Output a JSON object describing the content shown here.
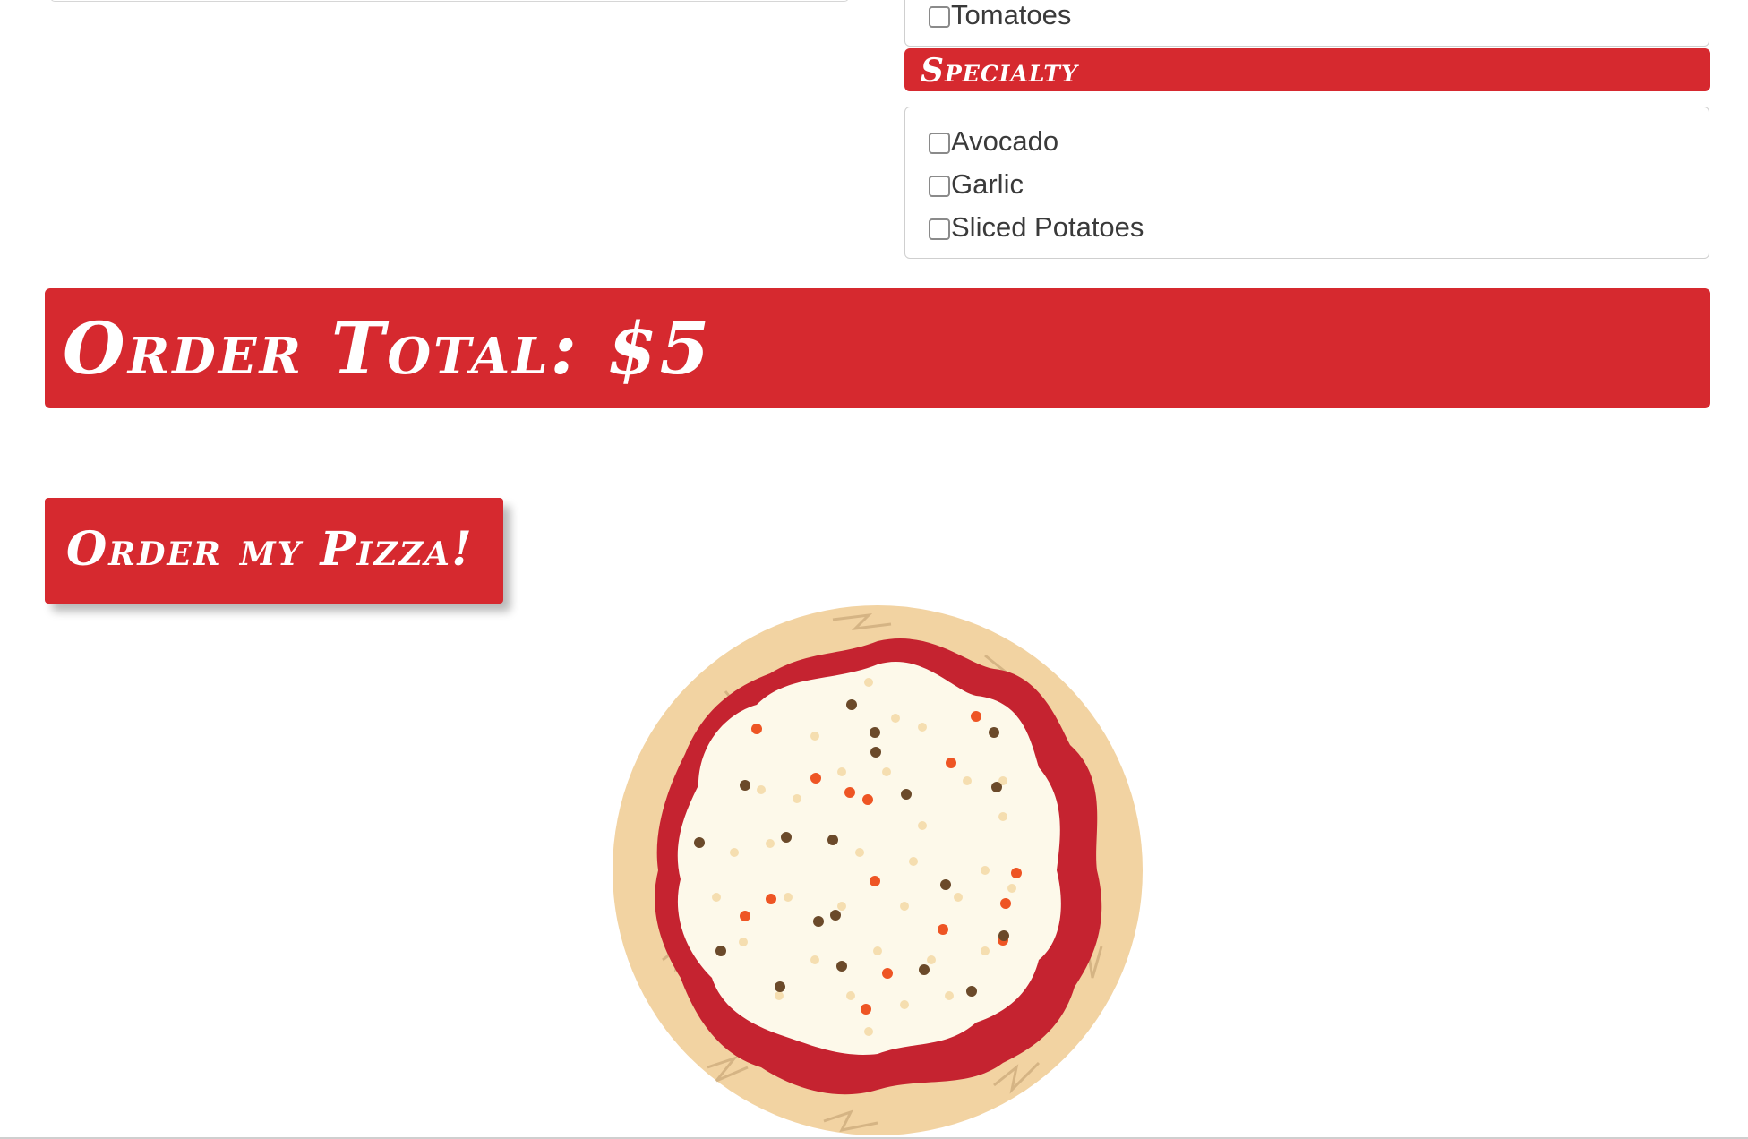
{
  "toppings_top": {
    "items": [
      {
        "label": "Tomatoes",
        "checked": false
      }
    ]
  },
  "specialty": {
    "title": "Specialty",
    "items": [
      {
        "label": "Avocado",
        "checked": false
      },
      {
        "label": "Garlic",
        "checked": false
      },
      {
        "label": "Sliced Potatoes",
        "checked": false
      }
    ]
  },
  "order": {
    "total_label": "Order Total: $5",
    "button_label": "Order my Pizza!"
  },
  "pizza": {
    "image": "pizza-preview-illustration",
    "colors": {
      "crust": "#f2d3a2",
      "sauce": "#c52330",
      "cheese": "#fdf9ea"
    }
  },
  "theme": {
    "accent": "#d6292f"
  }
}
